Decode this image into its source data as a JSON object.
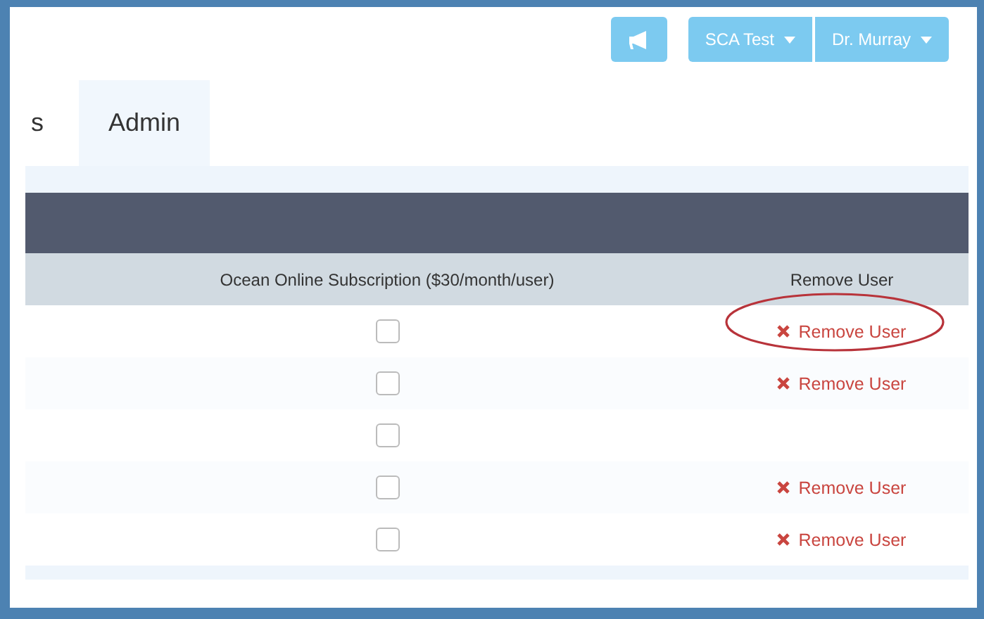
{
  "toolbar": {
    "menus": [
      {
        "label": "SCA Test"
      },
      {
        "label": "Dr. Murray"
      }
    ]
  },
  "tabs": [
    {
      "label": "s",
      "selected": false
    },
    {
      "label": "Admin",
      "selected": true
    }
  ],
  "table": {
    "columns": [
      "Ocean Online Subscription ($30/month/user)",
      "Remove User"
    ],
    "rows": [
      {
        "subscribed": false,
        "remove": "Remove User",
        "circled": true
      },
      {
        "subscribed": false,
        "remove": "Remove User",
        "circled": false
      },
      {
        "subscribed": false,
        "circled": false
      },
      {
        "subscribed": false,
        "remove": "Remove User",
        "circled": false
      },
      {
        "subscribed": false,
        "remove": "Remove User",
        "circled": false
      }
    ]
  }
}
